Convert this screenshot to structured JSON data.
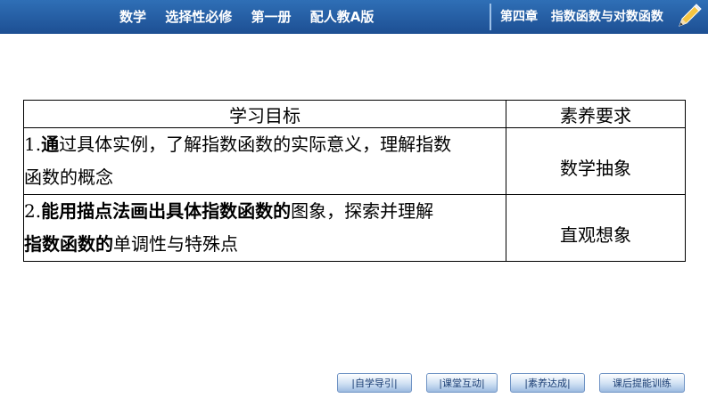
{
  "header": {
    "left_items": [
      "数学",
      "选择性必修",
      "第一册",
      "配人教A版"
    ],
    "chapter": "第四章",
    "chapter_title": "指数函数与对数函数",
    "pencil_icon": "pencil-icon"
  },
  "table": {
    "col_goal": "学习目标",
    "col_req": "素养要求",
    "rows": [
      {
        "num": "1.",
        "bold_part": "通",
        "rest_line1": "过具体实例，了解指数函数的实际意义，理解指数",
        "line2": "函数的概念",
        "req": "数学抽象"
      },
      {
        "num": "2.",
        "bold_part": "能用描点法画出具体指数函数的",
        "rest_line1": "图象，探索并理解",
        "line2_bold": "指数函数的",
        "line2_rest": "单调性与特殊点",
        "req": "直观想象"
      }
    ]
  },
  "nav": {
    "items": [
      "|自学导引|",
      "|课堂互动|",
      "|素养达成|",
      "课后提能训练"
    ]
  },
  "colors": {
    "header_bg": "#1d4f93",
    "nav_text": "#1a3d73"
  }
}
